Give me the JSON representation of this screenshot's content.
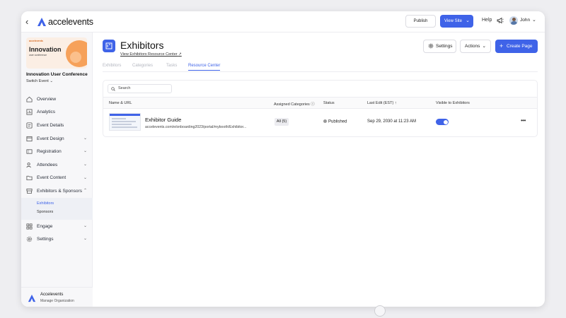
{
  "topbar": {
    "brand": "accelevents",
    "publish_label": "Publish",
    "view_site_label": "View Site",
    "help_label": "Help",
    "user_name": "John"
  },
  "sidebar": {
    "event_card": {
      "brand": "accelevents",
      "title": "Innovation",
      "subtitle": "user conference"
    },
    "event_name": "Innovation User Conference",
    "switch_event": "Switch Event",
    "items": [
      {
        "label": "Overview",
        "icon": "overview-icon"
      },
      {
        "label": "Analytics",
        "icon": "analytics-icon"
      },
      {
        "label": "Event Details",
        "icon": "event-details-icon"
      },
      {
        "label": "Event Design",
        "icon": "event-design-icon"
      },
      {
        "label": "Registration",
        "icon": "registration-icon"
      },
      {
        "label": "Attendees",
        "icon": "attendees-icon"
      },
      {
        "label": "Event Content",
        "icon": "folder-icon"
      },
      {
        "label": "Exhibitors & Sponsors",
        "icon": "exhibitors-icon"
      },
      {
        "label": "Engage",
        "icon": "engage-icon"
      },
      {
        "label": "Settings",
        "icon": "gear-icon"
      }
    ],
    "sub_items": [
      "Exhibitors",
      "Sponsors"
    ],
    "org": {
      "name": "Accelevents",
      "sub": "Manage Organization"
    }
  },
  "main": {
    "title": "Exhibitors",
    "link": "View Exhibitors Resource Center",
    "settings_label": "Settings",
    "actions_label": "Actions",
    "create_label": "Create Page",
    "tabs": [
      "Exhibitors",
      "Categories",
      "Tasks",
      "Resource Center"
    ],
    "search_placeholder": "Search",
    "columns": [
      "Name & URL",
      "Assigned Categories",
      "Status",
      "Last Edit (EST)",
      "Visible to Exhibitors"
    ],
    "rows": [
      {
        "title": "Exhibitor Guide",
        "url": "accelevents.com/e/onboarding2023/portal/mybooth/Exhibitor...",
        "categories": "All (5)",
        "status": "Published",
        "last_edit": "Sep 29, 2030 at 11:23 AM",
        "visible": true
      }
    ]
  },
  "colors": {
    "accent": "#3f63e8"
  }
}
